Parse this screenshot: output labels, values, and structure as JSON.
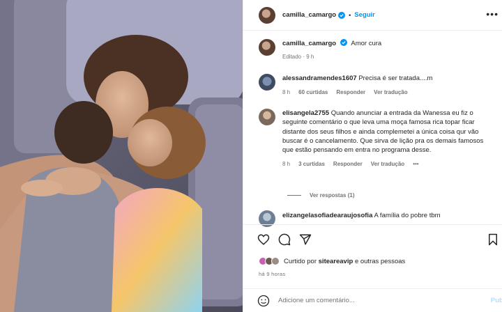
{
  "header": {
    "username": "camilla_camargo",
    "dot": "•",
    "follow_label": "Seguir",
    "more_icon": "more-horizontal-icon"
  },
  "caption": {
    "username": "camilla_camargo",
    "text": "Amor cura",
    "edited": "Editado · 9 h"
  },
  "comments": [
    {
      "username": "alessandramendes1607",
      "text": "Precisa é ser tratada....m",
      "time": "8 h",
      "likes": "60 curtidas",
      "reply": "Responder",
      "translate": "Ver tradução"
    },
    {
      "username": "elisangela2755",
      "text": "Quando anunciar a entrada da Wanessa eu fiz o seguinte comentário o que leva uma moça famosa rica topar ficar distante dos seus filhos e ainda complemetei a única coisa qur vão buscar é o cancelamento. Que sirva de lição pra os demais famosos que estão pensando em entra no programa desse.",
      "time": "8 h",
      "likes": "3 curtidas",
      "reply": "Responder",
      "translate": "Ver tradução",
      "more": "•••",
      "view_replies": "Ver respostas (1)"
    },
    {
      "username": "elizangelasofiadearaujosofia",
      "text": "A família do pobre tbm"
    }
  ],
  "actions": {
    "icons": [
      "heart-icon",
      "comment-icon",
      "share-icon",
      "bookmark-icon"
    ]
  },
  "likes": {
    "prefix": "Curtido por",
    "user": "siteareavip",
    "suffix": "e outras pessoas"
  },
  "time_ago": "há 9 horas",
  "add_comment": {
    "placeholder": "Adicione um comentário...",
    "publish": "Publi"
  },
  "colors": {
    "accent": "#0095f6",
    "muted": "#737373",
    "border": "#efefef"
  }
}
